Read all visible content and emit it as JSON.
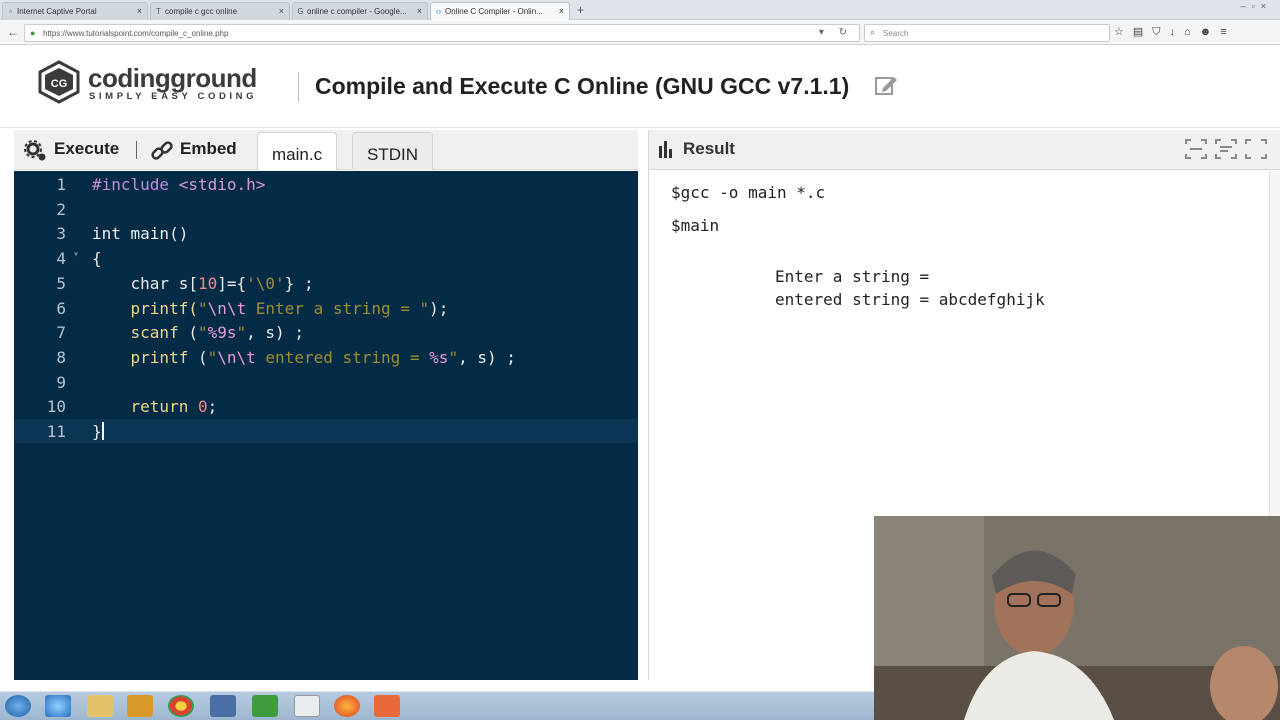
{
  "browser": {
    "tabs": [
      {
        "label": "Internet Captive Portal",
        "favicon": "page-icon"
      },
      {
        "label": "compile c gcc online",
        "favicon": "t-icon"
      },
      {
        "label": "online c compiler - Google...",
        "favicon": "google-icon"
      },
      {
        "label": "Online C Compiler - Onlin...",
        "favicon": "code-icon",
        "active": true
      }
    ],
    "url": "https://www.tutorialspoint.com/compile_c_online.php",
    "search_placeholder": "Search"
  },
  "site": {
    "logo_word": "codingground",
    "logo_tag": "SIMPLY EASY CODING",
    "title": "Compile and Execute C Online (GNU GCC v7.1.1)"
  },
  "editor_toolbar": {
    "execute_label": "Execute",
    "embed_label": "Embed",
    "tabs": [
      {
        "label": "main.c",
        "active": true
      },
      {
        "label": "STDIN",
        "active": false
      }
    ]
  },
  "editor": {
    "active_line": 11,
    "lines": [
      {
        "num": "1",
        "text": "#include <stdio.h>"
      },
      {
        "num": "2",
        "text": ""
      },
      {
        "num": "3",
        "text": "int main()"
      },
      {
        "num": "4",
        "text": "{"
      },
      {
        "num": "5",
        "text": "    char s[10]={'\\0'} ;"
      },
      {
        "num": "6",
        "text": "    printf(\"\\n\\t Enter a string = \");"
      },
      {
        "num": "7",
        "text": "    scanf (\"%9s\", s) ;"
      },
      {
        "num": "8",
        "text": "    printf (\"\\n\\t entered string = %s\", s) ;"
      },
      {
        "num": "9",
        "text": ""
      },
      {
        "num": "10",
        "text": "    return 0;"
      },
      {
        "num": "11",
        "text": "}"
      }
    ]
  },
  "result": {
    "title": "Result",
    "lines": [
      "$gcc -o main *.c",
      "$main",
      "Enter a string =",
      "entered string = abcdefghijk"
    ]
  },
  "colors": {
    "editor_bg": "#042b45",
    "toolbar_bg": "#f0f0f0"
  }
}
